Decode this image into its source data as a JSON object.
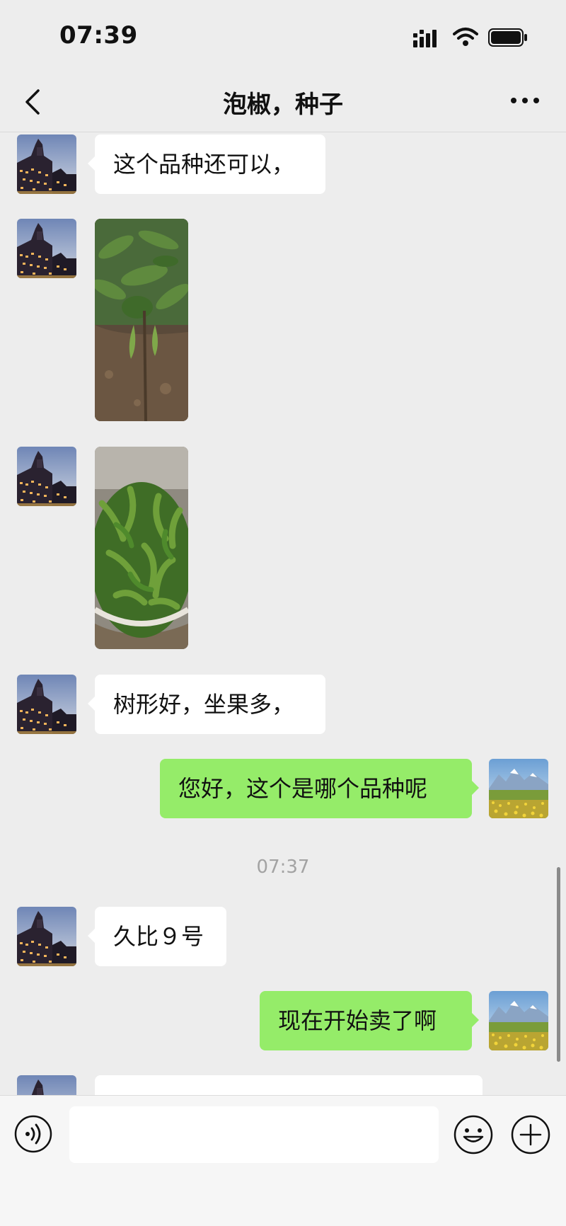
{
  "status_bar": {
    "time": "07:39"
  },
  "header": {
    "title": "泡椒，种子"
  },
  "messages": [
    {
      "side": "in",
      "type": "text",
      "text": "这个品种还可以，"
    },
    {
      "side": "in",
      "type": "image",
      "icon": "pepper-plant-photo"
    },
    {
      "side": "in",
      "type": "image",
      "icon": "harvested-peppers-photo"
    },
    {
      "side": "in",
      "type": "text",
      "text": "树形好，坐果多，"
    },
    {
      "side": "out",
      "type": "text",
      "text": "您好，这个是哪个品种呢"
    },
    {
      "type": "timestamp",
      "text": "07:37"
    },
    {
      "side": "in",
      "type": "text",
      "text": "久比９号"
    },
    {
      "side": "out",
      "type": "text",
      "text": "现在开始卖了啊"
    }
  ],
  "input_bar": {
    "value": "",
    "placeholder": ""
  },
  "colors": {
    "outgoing_bubble": "#95ec69",
    "incoming_bubble": "#ffffff",
    "background": "#ededed"
  }
}
